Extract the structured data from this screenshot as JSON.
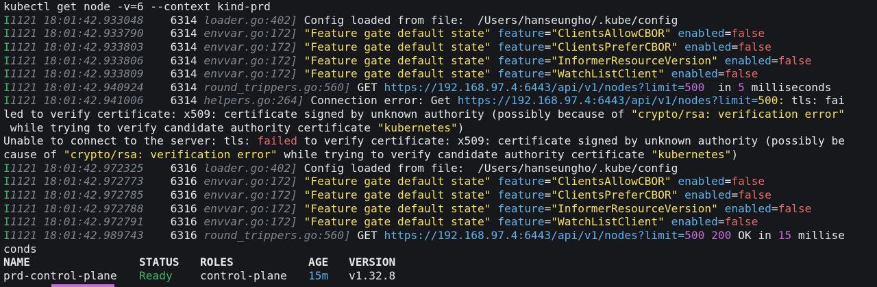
{
  "command": "kubectl get node -v=6 --context kind-prd",
  "logs_a": [
    {
      "lvl": "I",
      "ts": "1121 18:01:42.933048",
      "pid": "6314",
      "src": "loader.go:402]",
      "msg": " Config loaded from file:  /Users/hanseungho/.kube/config"
    },
    {
      "lvl": "I",
      "ts": "1121 18:01:42.933790",
      "pid": "6314",
      "src": "envvar.go:172]",
      "msg_str": "\"Feature gate default state\"",
      "f_key": "feature",
      "f_val": "\"ClientsAllowCBOR\"",
      "e_key": "enabled",
      "e_val": "false"
    },
    {
      "lvl": "I",
      "ts": "1121 18:01:42.933803",
      "pid": "6314",
      "src": "envvar.go:172]",
      "msg_str": "\"Feature gate default state\"",
      "f_key": "feature",
      "f_val": "\"ClientsPreferCBOR\"",
      "e_key": "enabled",
      "e_val": "false"
    },
    {
      "lvl": "I",
      "ts": "1121 18:01:42.933806",
      "pid": "6314",
      "src": "envvar.go:172]",
      "msg_str": "\"Feature gate default state\"",
      "f_key": "feature",
      "f_val": "\"InformerResourceVersion\"",
      "e_key": "enabled",
      "e_val": "false"
    },
    {
      "lvl": "I",
      "ts": "1121 18:01:42.933809",
      "pid": "6314",
      "src": "envvar.go:172]",
      "msg_str": "\"Feature gate default state\"",
      "f_key": "feature",
      "f_val": "\"WatchListClient\"",
      "e_key": "enabled",
      "e_val": "false"
    },
    {
      "lvl": "I",
      "ts": "1121 18:01:42.940924",
      "pid": "6314",
      "src": "round_trippers.go:560]",
      "get": " GET ",
      "url": "https://192.168.97.4:6443/api/v1/nodes?limit=",
      "limit": "500",
      "status": "",
      "in": "  in ",
      "ms": "5",
      "tail": " milliseconds"
    },
    {
      "lvl": "I",
      "ts": "1121 18:01:42.941006",
      "pid": "6314",
      "src": "helpers.go:264]",
      "msg": " Connection error: Get ",
      "url": "https://192.168.97.4:6443/api/v1/nodes?limit=",
      "limit": "500:",
      "tail": " tls: fai"
    }
  ],
  "err1": {
    "l1_a": "led to verify certificate: x509: certificate signed by unknown authority (possibly because of ",
    "l1_b": "\"crypto/rsa: verification error\"",
    "l2_a": " while trying to verify candidate authority certificate ",
    "l2_b": "\"kubernetes\"",
    "l2_c": ")"
  },
  "err2": {
    "l1_a": "Unable to connect to the server: tls: ",
    "l1_b": "failed",
    "l1_c": " to verify certificate: x509: certificate signed by unknown authority (possibly be",
    "l2_a": "cause of ",
    "l2_b": "\"crypto/rsa: verification error\"",
    "l2_c": " while trying to verify candidate authority certificate ",
    "l2_d": "\"kubernetes\"",
    "l2_e": ")"
  },
  "logs_b": [
    {
      "lvl": "I",
      "ts": "1121 18:01:42.972325",
      "pid": "6316",
      "src": "loader.go:402]",
      "msg": " Config loaded from file:  /Users/hanseungho/.kube/config"
    },
    {
      "lvl": "I",
      "ts": "1121 18:01:42.972773",
      "pid": "6316",
      "src": "envvar.go:172]",
      "msg_str": "\"Feature gate default state\"",
      "f_key": "feature",
      "f_val": "\"ClientsAllowCBOR\"",
      "e_key": "enabled",
      "e_val": "false"
    },
    {
      "lvl": "I",
      "ts": "1121 18:01:42.972785",
      "pid": "6316",
      "src": "envvar.go:172]",
      "msg_str": "\"Feature gate default state\"",
      "f_key": "feature",
      "f_val": "\"ClientsPreferCBOR\"",
      "e_key": "enabled",
      "e_val": "false"
    },
    {
      "lvl": "I",
      "ts": "1121 18:01:42.972788",
      "pid": "6316",
      "src": "envvar.go:172]",
      "msg_str": "\"Feature gate default state\"",
      "f_key": "feature",
      "f_val": "\"InformerResourceVersion\"",
      "e_key": "enabled",
      "e_val": "false"
    },
    {
      "lvl": "I",
      "ts": "1121 18:01:42.972791",
      "pid": "6316",
      "src": "envvar.go:172]",
      "msg_str": "\"Feature gate default state\"",
      "f_key": "feature",
      "f_val": "\"WatchListClient\"",
      "e_key": "enabled",
      "e_val": "false"
    },
    {
      "lvl": "I",
      "ts": "1121 18:01:42.989743",
      "pid": "6316",
      "src": "round_trippers.go:560]",
      "get": " GET ",
      "url": "https://192.168.97.4:6443/api/v1/nodes?limit=",
      "limit": "500",
      "status": "200",
      "in": " OK in ",
      "ms": "15",
      "tail": " millise"
    }
  ],
  "wrap_tail": "conds",
  "table": {
    "headers": [
      "NAME",
      "STATUS",
      "ROLES",
      "AGE",
      "VERSION"
    ],
    "row": [
      "prd-control-plane",
      "Ready",
      "control-plane",
      "15m",
      "v1.32.8"
    ]
  },
  "colors": {
    "background": "#16181c",
    "string": "#f2e15a",
    "key": "#5fb1e8",
    "error": "#e66a6a",
    "number": "#c86bdc",
    "ok": "#3fb56a"
  }
}
